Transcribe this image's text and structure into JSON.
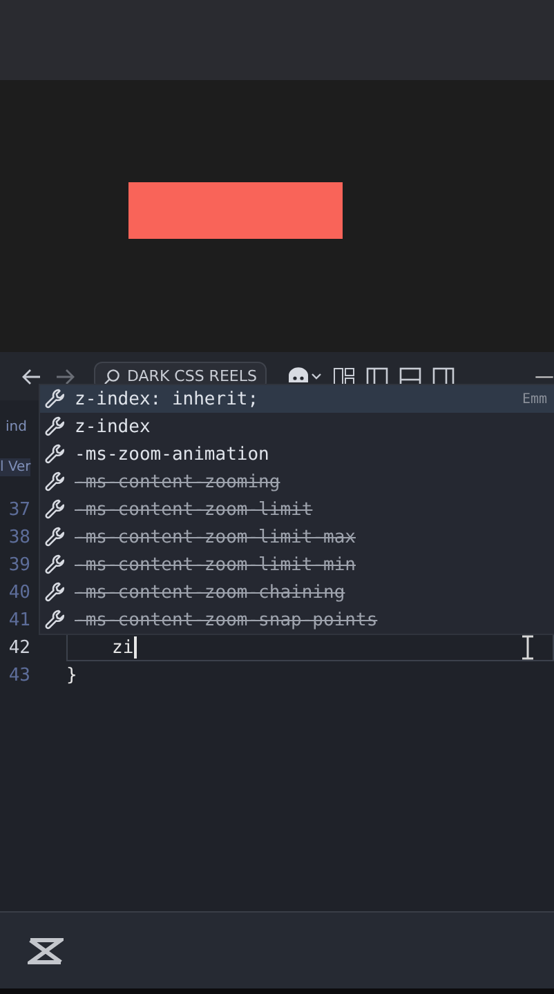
{
  "titlebar": {
    "search": "DARK CSS REELS",
    "minimize": "—"
  },
  "side_fragments": [
    "ind",
    "l Ver"
  ],
  "editor": {
    "lines": [
      {
        "number": "37",
        "current": false
      },
      {
        "number": "38",
        "current": false
      },
      {
        "number": "39",
        "current": false
      },
      {
        "number": "40",
        "current": false
      },
      {
        "number": "41",
        "current": false
      },
      {
        "number": "42",
        "text": "zi",
        "current": true
      },
      {
        "number": "43",
        "text": "}",
        "current": false
      }
    ]
  },
  "suggestions": [
    {
      "label": "z-index: inherit;",
      "selected": true,
      "deprecated": false,
      "detail": "Emm"
    },
    {
      "label": "z-index",
      "selected": false,
      "deprecated": false
    },
    {
      "label": "-ms-zoom-animation",
      "selected": false,
      "deprecated": false
    },
    {
      "label": "-ms-content-zooming",
      "selected": false,
      "deprecated": true
    },
    {
      "label": "-ms-content-zoom-limit",
      "selected": false,
      "deprecated": true
    },
    {
      "label": "-ms-content-zoom-limit-max",
      "selected": false,
      "deprecated": true
    },
    {
      "label": "-ms-content-zoom-limit-min",
      "selected": false,
      "deprecated": true
    },
    {
      "label": "-ms-content-zoom-chaining",
      "selected": false,
      "deprecated": true
    },
    {
      "label": "-ms-content-zoom-snap-points",
      "selected": false,
      "deprecated": true
    }
  ]
}
